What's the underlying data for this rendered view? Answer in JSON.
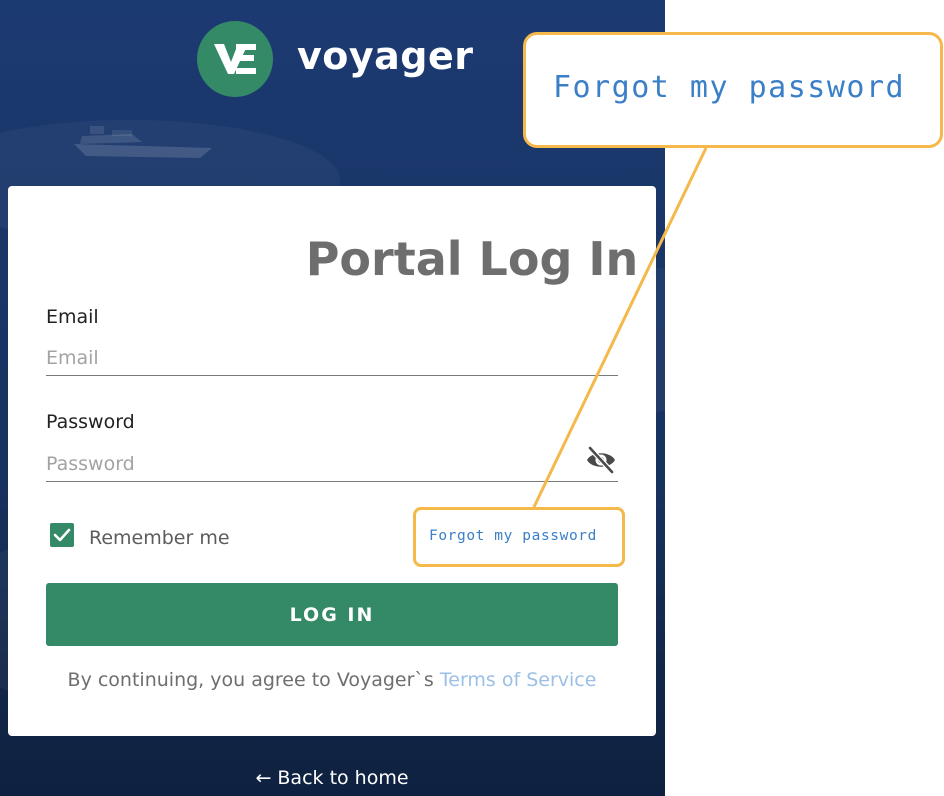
{
  "brand": {
    "name": "voyager"
  },
  "login": {
    "title": "Portal Log In",
    "email_label": "Email",
    "email_placeholder": "Email",
    "password_label": "Password",
    "password_placeholder": "Password",
    "remember_label": "Remember me",
    "remember_checked": true,
    "forgot_label": "Forgot my password",
    "submit_label": "LOG IN",
    "terms_prefix": "By continuing, you agree to Voyager`s ",
    "terms_link": "Terms of Service",
    "back_home": "← Back to home"
  },
  "callout": {
    "text": "Forgot my password"
  },
  "colors": {
    "brand_green": "#348a67",
    "background_navy": "#1a3668",
    "link_blue": "#3a7fc7",
    "highlight": "#f5b84a"
  },
  "icons": {
    "logo": "voyager-v-logo",
    "password_toggle": "eye-slash-icon",
    "checkbox": "check-icon"
  }
}
